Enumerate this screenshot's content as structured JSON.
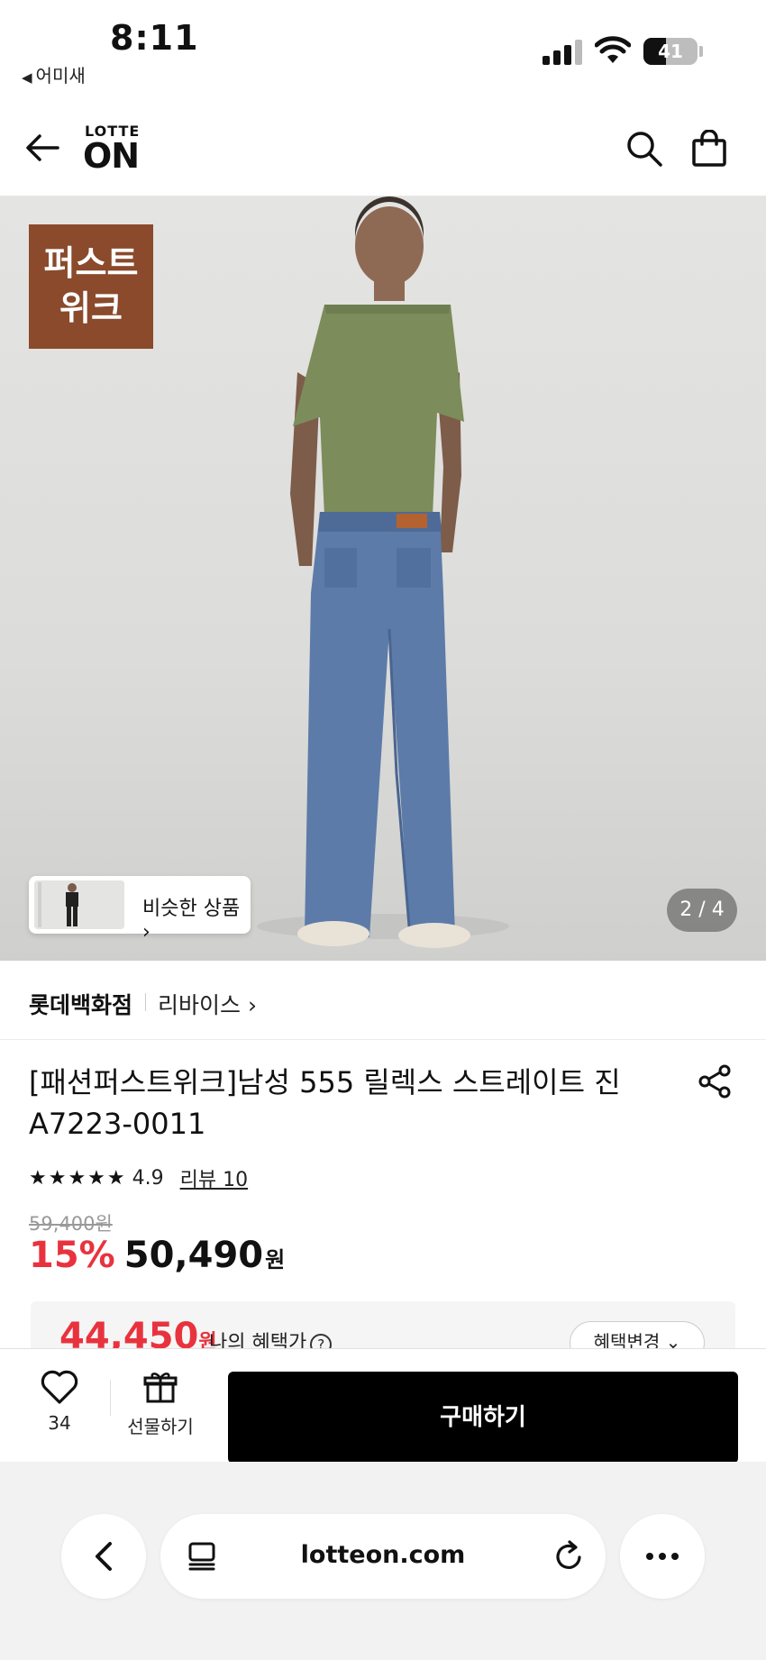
{
  "status_bar": {
    "time": "8:11",
    "back_app": "어미새",
    "battery_level": "41",
    "battery_fraction": 0.41
  },
  "header": {
    "logo_top": "LOTTE",
    "logo_bottom": "ON"
  },
  "hero": {
    "badge_line1": "퍼스트",
    "badge_line2": "위크",
    "similar_label": "비슷한 상품 ›",
    "pager": "2 / 4"
  },
  "seller": {
    "store": "롯데백화점",
    "brand": "리바이스 ›"
  },
  "product": {
    "title_line1": "[패션퍼스트위크]남성 555 릴렉스 스트레이트 진",
    "title_line2": "A7223-0011",
    "stars": "★★★★★",
    "rating": "4.9",
    "rating_value": 4.9,
    "review": "리뷰 10",
    "original_price": "59,400원",
    "discount": "15%",
    "price": "50,490",
    "won": "원"
  },
  "benefit": {
    "price": "44,450",
    "won": "원",
    "label": "나의 혜택가",
    "help": "?",
    "button": "혜택변경 ⌄"
  },
  "action_bar": {
    "like_count": "34",
    "gift_label": "선물하기",
    "buy_label": "구매하기"
  },
  "browser": {
    "url": "lotteon.com"
  },
  "colors": {
    "accent_red": "#e8333e",
    "badge_brown": "#8a4a2b",
    "buy_button": "#000000"
  }
}
